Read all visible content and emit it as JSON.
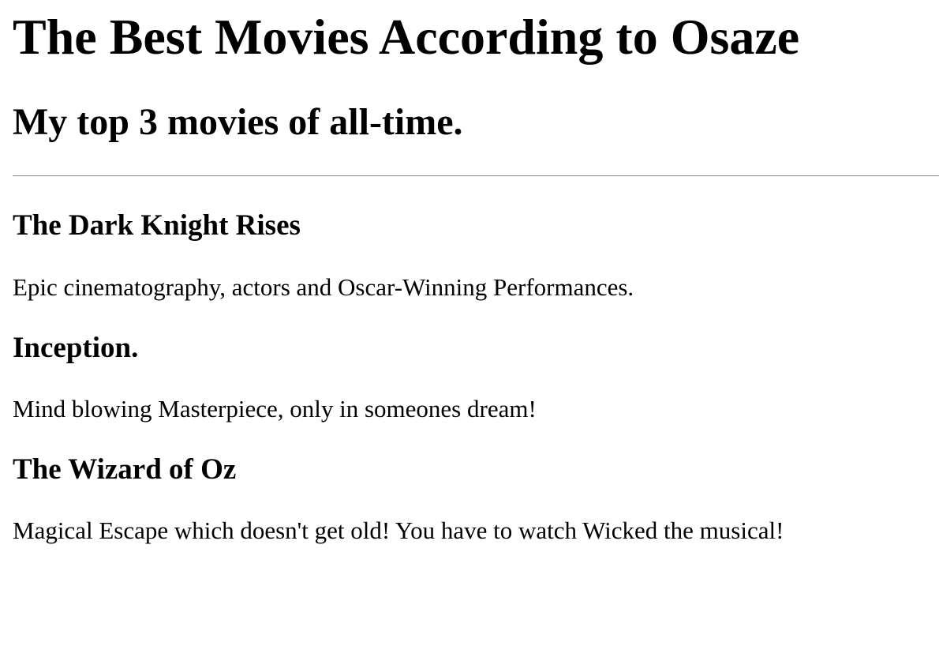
{
  "header": {
    "title": "The Best Movies According to Osaze",
    "subtitle": "My top 3 movies of all-time."
  },
  "movies": [
    {
      "title": "The Dark Knight Rises",
      "description": "Epic cinematography, actors and Oscar-Winning Performances."
    },
    {
      "title": "Inception.",
      "description": "Mind blowing Masterpiece, only in someones dream!"
    },
    {
      "title": "The Wizard of Oz",
      "description": "Magical Escape which doesn't get old! You have to watch Wicked the musical!"
    }
  ]
}
